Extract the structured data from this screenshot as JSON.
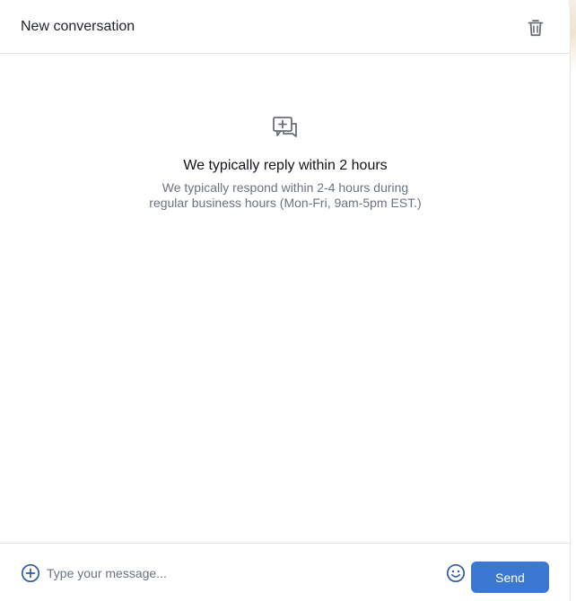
{
  "header": {
    "title": "New conversation",
    "delete_icon": "trash-icon"
  },
  "empty_state": {
    "icon": "add-chat-icon",
    "title": "We typically reply within 2 hours",
    "text": "We typically respond within 2-4 hours during regular business hours (Mon-Fri, 9am-5pm EST.)"
  },
  "composer": {
    "attach_icon": "plus-circle-icon",
    "placeholder": "Type your message...",
    "value": "",
    "emoji_icon": "smiley-icon",
    "send_label": "Send"
  },
  "colors": {
    "accent": "#3a78d1",
    "icon_blue": "#2e5aa8",
    "icon_gray": "#6b6f76",
    "border": "#e3e3e3"
  }
}
